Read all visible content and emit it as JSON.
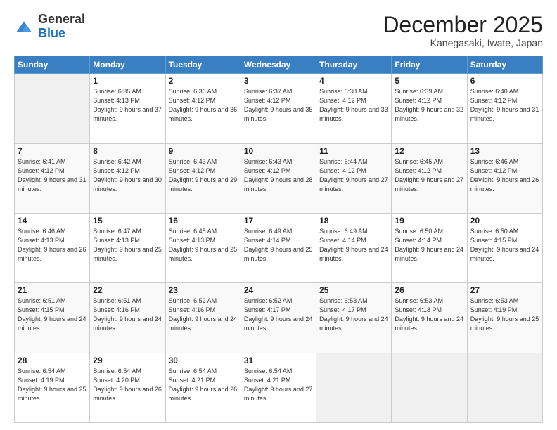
{
  "logo": {
    "general": "General",
    "blue": "Blue"
  },
  "title": "December 2025",
  "subtitle": "Kanegasaki, Iwate, Japan",
  "days_of_week": [
    "Sunday",
    "Monday",
    "Tuesday",
    "Wednesday",
    "Thursday",
    "Friday",
    "Saturday"
  ],
  "weeks": [
    [
      {
        "day": "",
        "sunrise": "",
        "sunset": "",
        "daylight": ""
      },
      {
        "day": "1",
        "sunrise": "Sunrise: 6:35 AM",
        "sunset": "Sunset: 4:13 PM",
        "daylight": "Daylight: 9 hours and 37 minutes."
      },
      {
        "day": "2",
        "sunrise": "Sunrise: 6:36 AM",
        "sunset": "Sunset: 4:12 PM",
        "daylight": "Daylight: 9 hours and 36 minutes."
      },
      {
        "day": "3",
        "sunrise": "Sunrise: 6:37 AM",
        "sunset": "Sunset: 4:12 PM",
        "daylight": "Daylight: 9 hours and 35 minutes."
      },
      {
        "day": "4",
        "sunrise": "Sunrise: 6:38 AM",
        "sunset": "Sunset: 4:12 PM",
        "daylight": "Daylight: 9 hours and 33 minutes."
      },
      {
        "day": "5",
        "sunrise": "Sunrise: 6:39 AM",
        "sunset": "Sunset: 4:12 PM",
        "daylight": "Daylight: 9 hours and 32 minutes."
      },
      {
        "day": "6",
        "sunrise": "Sunrise: 6:40 AM",
        "sunset": "Sunset: 4:12 PM",
        "daylight": "Daylight: 9 hours and 31 minutes."
      }
    ],
    [
      {
        "day": "7",
        "sunrise": "Sunrise: 6:41 AM",
        "sunset": "Sunset: 4:12 PM",
        "daylight": "Daylight: 9 hours and 31 minutes."
      },
      {
        "day": "8",
        "sunrise": "Sunrise: 6:42 AM",
        "sunset": "Sunset: 4:12 PM",
        "daylight": "Daylight: 9 hours and 30 minutes."
      },
      {
        "day": "9",
        "sunrise": "Sunrise: 6:43 AM",
        "sunset": "Sunset: 4:12 PM",
        "daylight": "Daylight: 9 hours and 29 minutes."
      },
      {
        "day": "10",
        "sunrise": "Sunrise: 6:43 AM",
        "sunset": "Sunset: 4:12 PM",
        "daylight": "Daylight: 9 hours and 28 minutes."
      },
      {
        "day": "11",
        "sunrise": "Sunrise: 6:44 AM",
        "sunset": "Sunset: 4:12 PM",
        "daylight": "Daylight: 9 hours and 27 minutes."
      },
      {
        "day": "12",
        "sunrise": "Sunrise: 6:45 AM",
        "sunset": "Sunset: 4:12 PM",
        "daylight": "Daylight: 9 hours and 27 minutes."
      },
      {
        "day": "13",
        "sunrise": "Sunrise: 6:46 AM",
        "sunset": "Sunset: 4:12 PM",
        "daylight": "Daylight: 9 hours and 26 minutes."
      }
    ],
    [
      {
        "day": "14",
        "sunrise": "Sunrise: 6:46 AM",
        "sunset": "Sunset: 4:13 PM",
        "daylight": "Daylight: 9 hours and 26 minutes."
      },
      {
        "day": "15",
        "sunrise": "Sunrise: 6:47 AM",
        "sunset": "Sunset: 4:13 PM",
        "daylight": "Daylight: 9 hours and 25 minutes."
      },
      {
        "day": "16",
        "sunrise": "Sunrise: 6:48 AM",
        "sunset": "Sunset: 4:13 PM",
        "daylight": "Daylight: 9 hours and 25 minutes."
      },
      {
        "day": "17",
        "sunrise": "Sunrise: 6:49 AM",
        "sunset": "Sunset: 4:14 PM",
        "daylight": "Daylight: 9 hours and 25 minutes."
      },
      {
        "day": "18",
        "sunrise": "Sunrise: 6:49 AM",
        "sunset": "Sunset: 4:14 PM",
        "daylight": "Daylight: 9 hours and 24 minutes."
      },
      {
        "day": "19",
        "sunrise": "Sunrise: 6:50 AM",
        "sunset": "Sunset: 4:14 PM",
        "daylight": "Daylight: 9 hours and 24 minutes."
      },
      {
        "day": "20",
        "sunrise": "Sunrise: 6:50 AM",
        "sunset": "Sunset: 4:15 PM",
        "daylight": "Daylight: 9 hours and 24 minutes."
      }
    ],
    [
      {
        "day": "21",
        "sunrise": "Sunrise: 6:51 AM",
        "sunset": "Sunset: 4:15 PM",
        "daylight": "Daylight: 9 hours and 24 minutes."
      },
      {
        "day": "22",
        "sunrise": "Sunrise: 6:51 AM",
        "sunset": "Sunset: 4:16 PM",
        "daylight": "Daylight: 9 hours and 24 minutes."
      },
      {
        "day": "23",
        "sunrise": "Sunrise: 6:52 AM",
        "sunset": "Sunset: 4:16 PM",
        "daylight": "Daylight: 9 hours and 24 minutes."
      },
      {
        "day": "24",
        "sunrise": "Sunrise: 6:52 AM",
        "sunset": "Sunset: 4:17 PM",
        "daylight": "Daylight: 9 hours and 24 minutes."
      },
      {
        "day": "25",
        "sunrise": "Sunrise: 6:53 AM",
        "sunset": "Sunset: 4:17 PM",
        "daylight": "Daylight: 9 hours and 24 minutes."
      },
      {
        "day": "26",
        "sunrise": "Sunrise: 6:53 AM",
        "sunset": "Sunset: 4:18 PM",
        "daylight": "Daylight: 9 hours and 24 minutes."
      },
      {
        "day": "27",
        "sunrise": "Sunrise: 6:53 AM",
        "sunset": "Sunset: 4:19 PM",
        "daylight": "Daylight: 9 hours and 25 minutes."
      }
    ],
    [
      {
        "day": "28",
        "sunrise": "Sunrise: 6:54 AM",
        "sunset": "Sunset: 4:19 PM",
        "daylight": "Daylight: 9 hours and 25 minutes."
      },
      {
        "day": "29",
        "sunrise": "Sunrise: 6:54 AM",
        "sunset": "Sunset: 4:20 PM",
        "daylight": "Daylight: 9 hours and 26 minutes."
      },
      {
        "day": "30",
        "sunrise": "Sunrise: 6:54 AM",
        "sunset": "Sunset: 4:21 PM",
        "daylight": "Daylight: 9 hours and 26 minutes."
      },
      {
        "day": "31",
        "sunrise": "Sunrise: 6:54 AM",
        "sunset": "Sunset: 4:21 PM",
        "daylight": "Daylight: 9 hours and 27 minutes."
      },
      {
        "day": "",
        "sunrise": "",
        "sunset": "",
        "daylight": ""
      },
      {
        "day": "",
        "sunrise": "",
        "sunset": "",
        "daylight": ""
      },
      {
        "day": "",
        "sunrise": "",
        "sunset": "",
        "daylight": ""
      }
    ]
  ]
}
